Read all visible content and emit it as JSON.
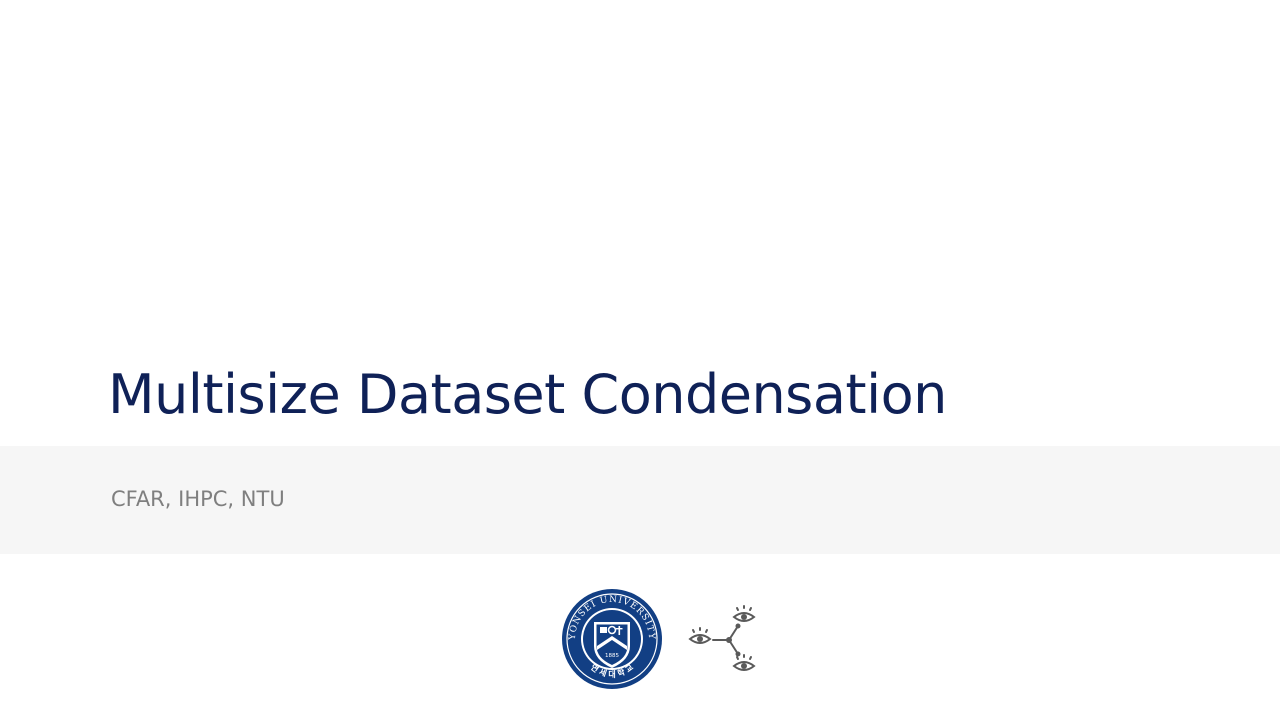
{
  "slide": {
    "title": "Multisize Dataset Condensation",
    "subtitle": "CFAR, IHPC, NTU"
  },
  "logos": {
    "yonsei": {
      "ring_text_top": "YONSEI UNIVERSITY",
      "ring_text_bottom": "연 세 대 학 교",
      "year": "1885",
      "icon": "yonsei-university-seal"
    },
    "lab": {
      "icon": "eyes-network-logo"
    }
  },
  "colors": {
    "title": "#0f2157",
    "subtitle": "#7f7f7f",
    "band": "#f6f6f6",
    "yonsei_blue": "#123f84",
    "lab_gray": "#5a5a5a"
  }
}
